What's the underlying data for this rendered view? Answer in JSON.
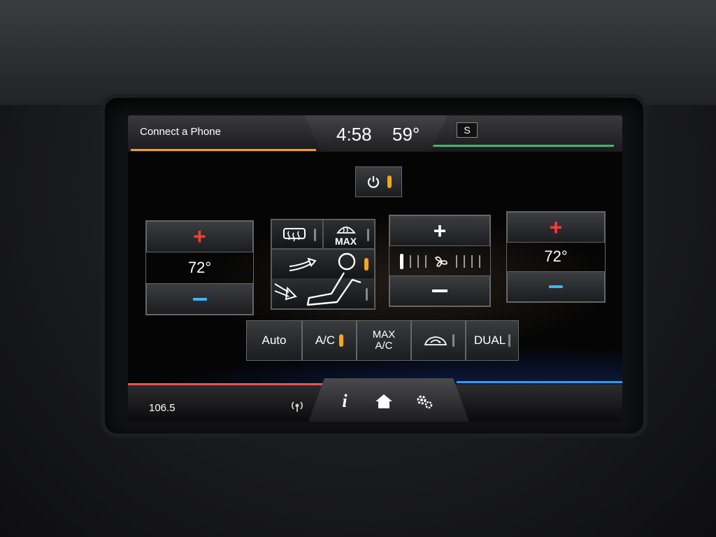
{
  "status": {
    "phone": "Connect a Phone",
    "time": "4:58",
    "outside_temp": "59°",
    "sync_badge": "S"
  },
  "climate": {
    "driver_temp": "72°",
    "passenger_temp": "72°",
    "plus_symbol": "+",
    "fan_plus": "+",
    "fan_level": 1,
    "fan_levels_total": 8,
    "max_label": "MAX",
    "auto_label": "Auto",
    "ac_label": "A/C",
    "max_ac_top": "MAX",
    "max_ac_bottom": "A/C",
    "dual_label": "DUAL"
  },
  "radio": {
    "frequency": "106.5"
  },
  "nav": {
    "info_symbol": "i"
  },
  "colors": {
    "amber_indicator": "#f3a81b",
    "red_plus": "#ff3b30",
    "blue_minus": "#3ab7ff",
    "accent_green": "#3fb86a",
    "accent_red": "#ff4f4f",
    "accent_blue": "#2d9cff"
  },
  "icons": {
    "power": "power-icon",
    "rear_defrost": "rear-defrost-icon",
    "max_defrost": "max-defrost-icon",
    "airflow_face": "airflow-face-icon",
    "airflow_feet": "airflow-feet-icon",
    "fan": "fan-icon",
    "recirculation": "recirculation-icon",
    "radio_signal": "radio-signal-icon",
    "info": "info-icon",
    "home": "home-icon",
    "settings": "gear-icon"
  }
}
